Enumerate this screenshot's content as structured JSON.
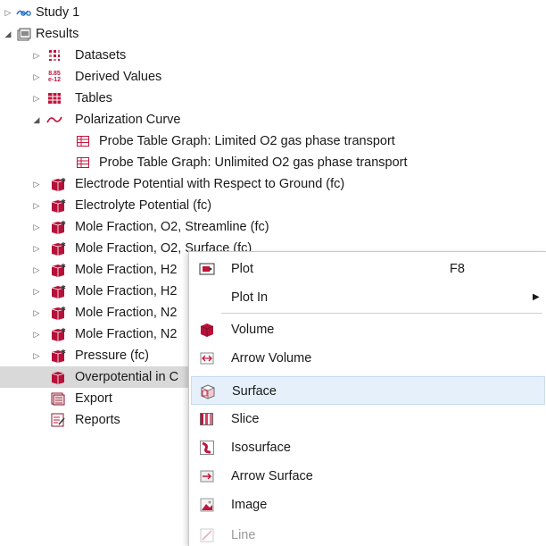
{
  "tree": {
    "rows": [
      {
        "label": "Study 1",
        "icon": "study-icon"
      },
      {
        "label": "Results",
        "icon": "results-icon"
      },
      {
        "label": "Datasets",
        "icon": "datasets-icon"
      },
      {
        "label": "Derived Values",
        "icon": "derived-values-icon",
        "icon_text": "8.85 e-12"
      },
      {
        "label": "Tables",
        "icon": "tables-icon"
      },
      {
        "label": "Polarization Curve",
        "icon": "plot-group-1d-icon"
      },
      {
        "label": "Probe Table Graph: Limited O2 gas phase transport",
        "icon": "table-graph-icon"
      },
      {
        "label": "Probe Table Graph: Unlimited O2 gas phase transport",
        "icon": "table-graph-icon"
      },
      {
        "label": "Electrode Potential with Respect to Ground (fc)",
        "icon": "plot-group-3d-icon"
      },
      {
        "label": "Electrolyte Potential (fc)",
        "icon": "plot-group-3d-icon"
      },
      {
        "label": "Mole Fraction, O2, Streamline (fc)",
        "icon": "plot-group-3d-icon"
      },
      {
        "label": "Mole Fraction, O2, Surface (fc)",
        "icon": "plot-group-3d-icon"
      },
      {
        "label": "Mole Fraction, H2",
        "icon": "plot-group-3d-icon"
      },
      {
        "label": "Mole Fraction, H2",
        "icon": "plot-group-3d-icon"
      },
      {
        "label": "Mole Fraction, N2",
        "icon": "plot-group-3d-icon"
      },
      {
        "label": "Mole Fraction, N2",
        "icon": "plot-group-3d-icon"
      },
      {
        "label": "Pressure (fc)",
        "icon": "plot-group-3d-icon"
      },
      {
        "label": "Overpotential in C",
        "icon": "plot-group-3d-icon"
      },
      {
        "label": "Export",
        "icon": "export-icon"
      },
      {
        "label": "Reports",
        "icon": "reports-icon"
      }
    ]
  },
  "menu": {
    "items": [
      {
        "label": "Plot",
        "shortcut": "F8",
        "icon": "plot-icon"
      },
      {
        "label": "Plot In",
        "icon": "",
        "submenu_arrow": "▶"
      },
      {
        "label": "Volume",
        "icon": "volume-icon"
      },
      {
        "label": "Arrow Volume",
        "icon": "arrow-volume-icon"
      },
      {
        "label": "Surface",
        "icon": "surface-icon"
      },
      {
        "label": "Slice",
        "icon": "slice-icon"
      },
      {
        "label": "Isosurface",
        "icon": "isosurface-icon"
      },
      {
        "label": "Arrow Surface",
        "icon": "arrow-surface-icon"
      },
      {
        "label": "Image",
        "icon": "image-icon"
      },
      {
        "label": "Line",
        "icon": "line-icon"
      }
    ]
  },
  "colors": {
    "plot_group_red": "#b5123a",
    "tables_red": "#c0143c",
    "study_blue": "#2a74c9",
    "selection_gray": "#d9d9d9",
    "menu_highlight": "#e6f0fa"
  }
}
